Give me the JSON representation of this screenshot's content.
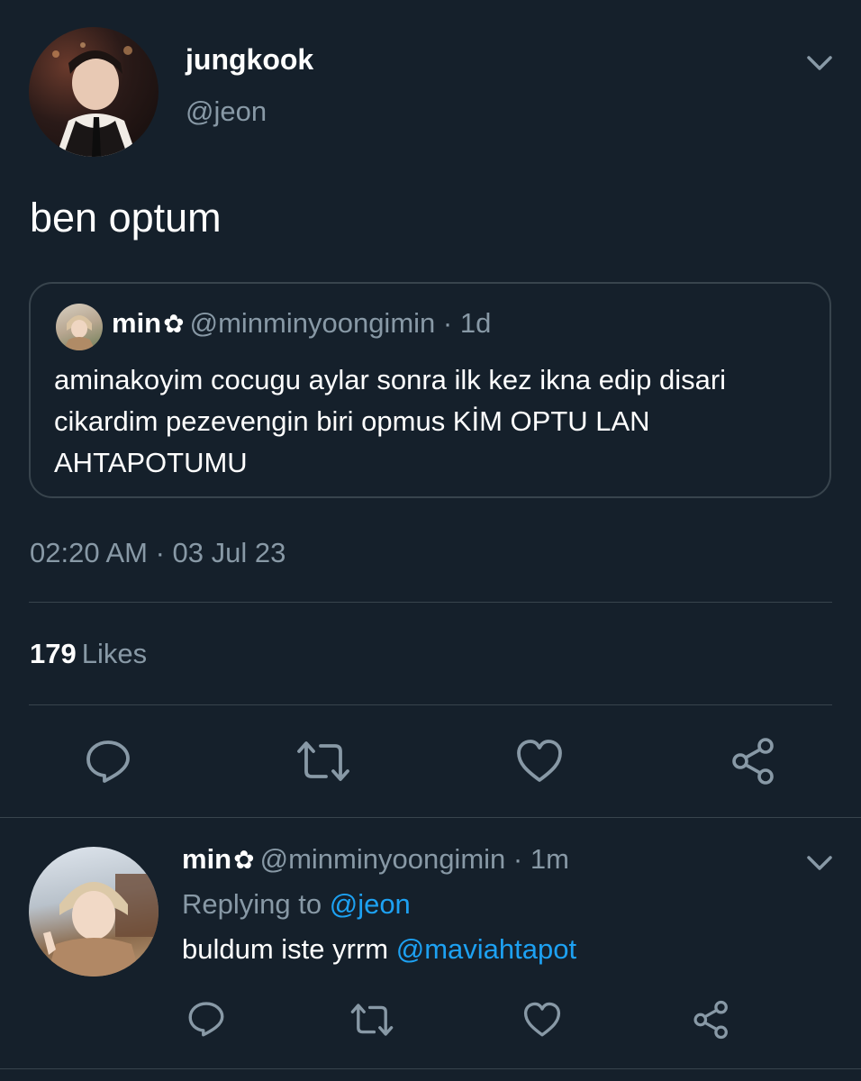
{
  "main_tweet": {
    "author_name": "jungkook",
    "author_handle": "@jeon",
    "text": "ben optum",
    "timestamp": "02:20 AM · 03 Jul 23",
    "likes_count": "179",
    "likes_label": "Likes"
  },
  "quoted_tweet": {
    "author_name": "min",
    "name_emoji": "✿",
    "author_handle": "@minminyoongimin",
    "separator": "·",
    "time": "1d",
    "text": "aminakoyim cocugu aylar sonra ilk kez ikna edip disari cikardim pezevengin biri opmus KİM OPTU LAN AHTAPOTUMU"
  },
  "reply_tweet": {
    "author_name": "min",
    "name_emoji": "✿",
    "author_handle": "@minminyoongimin",
    "separator": "·",
    "time": "1m",
    "replying_label": "Replying to",
    "replying_handle": "@jeon",
    "text": "buldum iste yrrm",
    "mention": "@maviahtapot"
  },
  "icons": {
    "more": "chevron-down-icon",
    "reply": "reply-icon",
    "retweet": "retweet-icon",
    "like": "heart-icon",
    "share": "share-icon"
  },
  "colors": {
    "background": "#15202b",
    "secondary_text": "#8899a6",
    "link": "#1da1f2",
    "border": "#38444d"
  }
}
